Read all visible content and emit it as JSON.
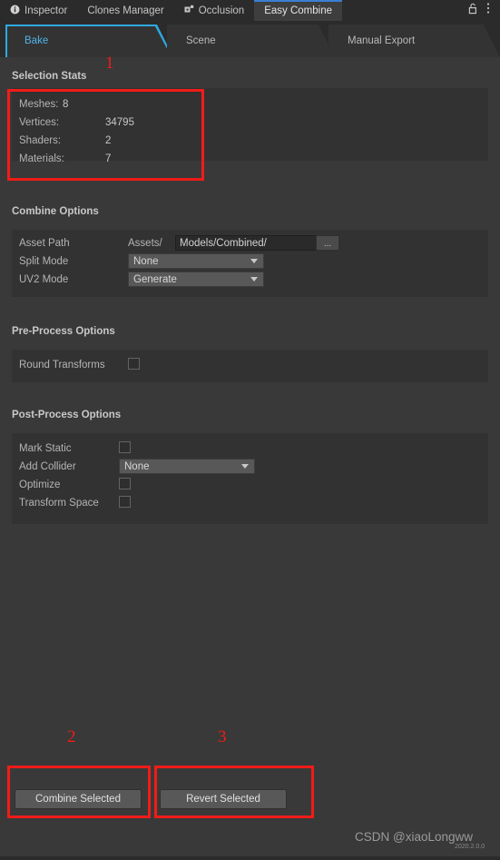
{
  "window": {
    "tabs": [
      {
        "label": "Inspector",
        "icon": "info-icon",
        "active": false
      },
      {
        "label": "Clones Manager",
        "icon": "",
        "active": false
      },
      {
        "label": "Occlusion",
        "icon": "occlusion-icon",
        "active": false
      },
      {
        "label": "Easy Combine",
        "icon": "",
        "active": true
      }
    ],
    "lock_icon": "lock-icon",
    "menu_icon": "kebab-menu-icon"
  },
  "subtabs": [
    {
      "label": "Bake",
      "active": true
    },
    {
      "label": "Scene",
      "active": false
    },
    {
      "label": "Manual Export",
      "active": false
    }
  ],
  "selection_stats": {
    "title": "Selection Stats",
    "rows": [
      {
        "label": "Meshes:",
        "value": "8",
        "inline": true
      },
      {
        "label": "Vertices:",
        "value": "34795",
        "inline": false
      },
      {
        "label": "Shaders:",
        "value": "2",
        "inline": false
      },
      {
        "label": "Materials:",
        "value": "7",
        "inline": false
      }
    ]
  },
  "combine_options": {
    "title": "Combine Options",
    "asset_path": {
      "label": "Asset Path",
      "prefix": "Assets/",
      "value": "Models/Combined/",
      "browse_label": "..."
    },
    "split_mode": {
      "label": "Split Mode",
      "value": "None"
    },
    "uv2_mode": {
      "label": "UV2 Mode",
      "value": "Generate"
    }
  },
  "pre_process_options": {
    "title": "Pre-Process Options",
    "round_transforms": {
      "label": "Round Transforms",
      "checked": false
    }
  },
  "post_process_options": {
    "title": "Post-Process Options",
    "mark_static": {
      "label": "Mark Static",
      "checked": false
    },
    "add_collider": {
      "label": "Add Collider",
      "value": "None"
    },
    "optimize": {
      "label": "Optimize",
      "checked": false
    },
    "transform_space": {
      "label": "Transform Space",
      "checked": false
    }
  },
  "actions": {
    "combine_selected": "Combine Selected",
    "revert_selected": "Revert Selected"
  },
  "annotations": [
    {
      "number": "1"
    },
    {
      "number": "2"
    },
    {
      "number": "3"
    }
  ],
  "watermark": "CSDN @xiaoLongww",
  "version": "2020.2.0.0",
  "colors": {
    "accent_tab": "#3b7fd4",
    "accent_subtab": "#2fa8e0",
    "annotation_red": "#f01c18",
    "panel_bg": "#393939",
    "groupbox_bg": "#323232"
  }
}
